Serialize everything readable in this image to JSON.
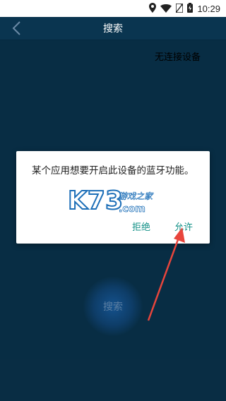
{
  "status_bar": {
    "time": "10:29",
    "icons": [
      "location-icon",
      "wifi-icon",
      "no-sim-icon",
      "battery-charging-icon"
    ]
  },
  "app_bar": {
    "title": "搜索",
    "back_icon": "back-icon"
  },
  "device_status": "无连接设备",
  "search_button_label": "搜索",
  "dialog": {
    "message": "某个应用想要开启此设备的蓝牙功能。",
    "deny_label": "拒绝",
    "allow_label": "允许"
  },
  "watermark": {
    "logo_text": "K73",
    "subtitle": "游戏之家",
    "domain": ".com"
  },
  "colors": {
    "background": "#0a3550",
    "dialog_button": "#119086",
    "annotation_arrow": "#e8453c"
  }
}
